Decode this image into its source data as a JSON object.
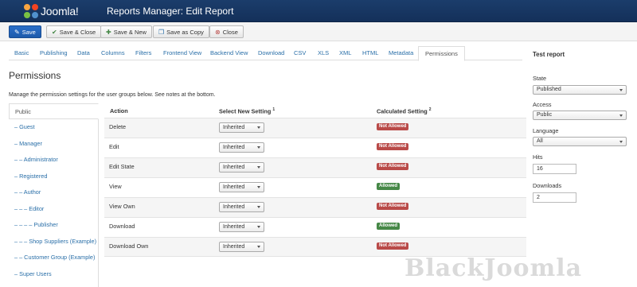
{
  "header": {
    "logo_text": "Joomla!",
    "title": "Reports Manager: Edit Report"
  },
  "toolbar": {
    "save": "Save",
    "save_close": "Save & Close",
    "save_new": "Save & New",
    "save_copy": "Save as Copy",
    "close": "Close"
  },
  "tabs": [
    "Basic",
    "Publishing",
    "Data",
    "Columns",
    "Filters",
    "Frontend View",
    "Backend View",
    "Download",
    "CSV",
    "XLS",
    "XML",
    "HTML",
    "Metadata",
    "Permissions"
  ],
  "section": {
    "title": "Permissions",
    "note": "Manage the permission settings for the user groups below. See notes at the bottom."
  },
  "groups": [
    "Public",
    "– Guest",
    "– Manager",
    "– – Administrator",
    "– Registered",
    "– – Author",
    "– – – Editor",
    "– – – – Publisher",
    "– – – Shop Suppliers (Example)",
    "– – Customer Group (Example)",
    "– Super Users"
  ],
  "table": {
    "col_action": "Action",
    "col_select": "Select New Setting",
    "col_select_sup": "1",
    "col_calc": "Calculated Setting",
    "col_calc_sup": "2",
    "rows": [
      {
        "action": "Delete",
        "setting": "Inherited",
        "calculated": "Not Allowed",
        "allowed": false
      },
      {
        "action": "Edit",
        "setting": "Inherited",
        "calculated": "Not Allowed",
        "allowed": false
      },
      {
        "action": "Edit State",
        "setting": "Inherited",
        "calculated": "Not Allowed",
        "allowed": false
      },
      {
        "action": "View",
        "setting": "Inherited",
        "calculated": "Allowed",
        "allowed": true
      },
      {
        "action": "View Own",
        "setting": "Inherited",
        "calculated": "Not Allowed",
        "allowed": false
      },
      {
        "action": "Download",
        "setting": "Inherited",
        "calculated": "Allowed",
        "allowed": true
      },
      {
        "action": "Download Own",
        "setting": "Inherited",
        "calculated": "Not Allowed",
        "allowed": false
      }
    ]
  },
  "sidebar": {
    "title": "Test report",
    "state_label": "State",
    "state_value": "Published",
    "access_label": "Access",
    "access_value": "Public",
    "language_label": "Language",
    "language_value": "All",
    "hits_label": "Hits",
    "hits_value": "16",
    "downloads_label": "Downloads",
    "downloads_value": "2"
  },
  "watermark": "BlackJoomla",
  "colors": {
    "header": "#1b3d6b",
    "primary": "#2a6fc9",
    "link": "#2a6fa8",
    "not_allowed": "#b94a48",
    "allowed": "#468847"
  }
}
